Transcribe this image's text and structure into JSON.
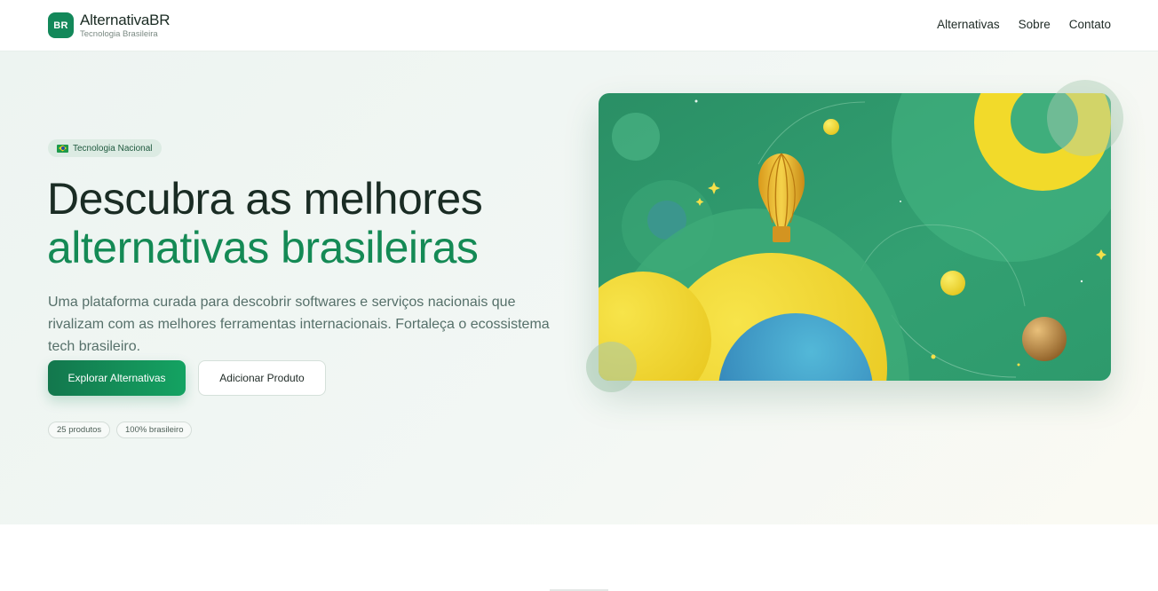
{
  "header": {
    "logo_initials": "BR",
    "brand_name": "AlternativaBR",
    "brand_tagline": "Tecnologia Brasileira",
    "nav": [
      {
        "label": "Alternativas"
      },
      {
        "label": "Sobre"
      },
      {
        "label": "Contato"
      }
    ]
  },
  "hero": {
    "badge": "Tecnologia Nacional",
    "title_line1": "Descubra as melhores",
    "title_line2": "alternativas brasileiras",
    "subtitle": "Uma plataforma curada para descobrir softwares e serviços nacionais que rivalizam com as melhores ferramentas internacionais. Fortaleça o ecossistema tech brasileiro.",
    "primary_cta": "Explorar Alternativas",
    "secondary_cta": "Adicionar Produto",
    "stats": [
      "25 produtos",
      "100% brasileiro"
    ]
  },
  "icons": {
    "badge_flag": "brazil-flag-icon",
    "illustration": "hot-air-balloon-planets-illustration"
  },
  "colors": {
    "brand_green": "#13885a",
    "headline_dark": "#1a2c24",
    "headline_accent": "#148a55",
    "illustration_bg": "#2e9c6f",
    "accent_yellow": "#f2da2a",
    "accent_blue": "#3a90c2"
  }
}
